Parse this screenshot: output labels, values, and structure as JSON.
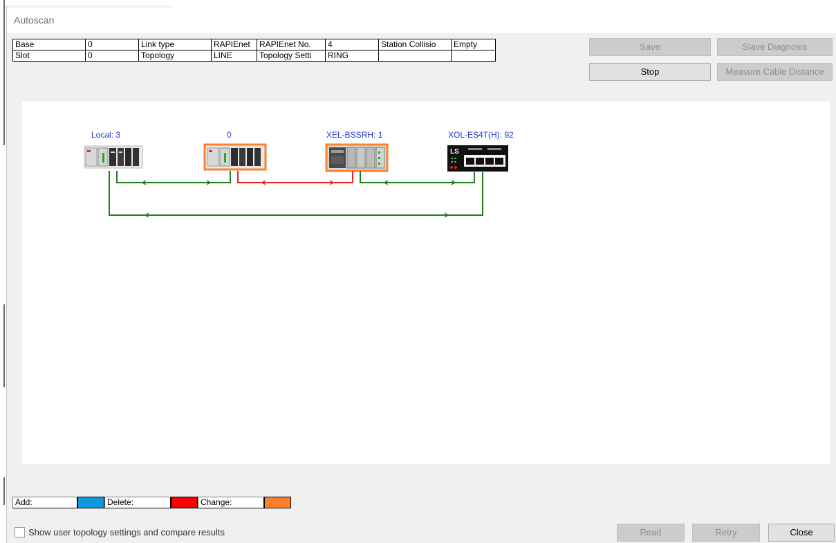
{
  "window": {
    "title": "Autoscan"
  },
  "info_table": {
    "row1": [
      "Base",
      "0",
      "Link type",
      "RAPIEnet",
      "RAPIEnet No.",
      "4",
      "Station Collisio",
      "Empty"
    ],
    "row2": [
      "Slot",
      "0",
      "Topology",
      "LINE",
      "Topology Setti",
      "RING",
      "",
      ""
    ]
  },
  "buttons": {
    "save": "Save",
    "slave_diagnosis": "Slave Diagnosis",
    "stop": "Stop",
    "measure_cable": "Measure Cable Distance",
    "read": "Read",
    "retry": "Retry",
    "close": "Close"
  },
  "nodes": [
    {
      "label": "Local: 3",
      "device": "plc-rack-icon"
    },
    {
      "label": "0",
      "device": "plc-rack-icon"
    },
    {
      "label": "XEL-BSSRH: 1",
      "device": "io-module-icon"
    },
    {
      "label": "XOL-ES4T(H): 92",
      "device": "ethernet-switch-icon"
    }
  ],
  "legend": {
    "add": "Add:",
    "add_color": "#0b9ae0",
    "delete": "Delete:",
    "delete_color": "#ff0000",
    "change": "Change:",
    "change_color": "#ff7f2a"
  },
  "link_colors": {
    "ok": "#1a7f1a",
    "error": "#ee2222",
    "changed_border": "#ff7f2a"
  },
  "checkbox": {
    "label": "Show user topology settings and compare results",
    "checked": false
  }
}
